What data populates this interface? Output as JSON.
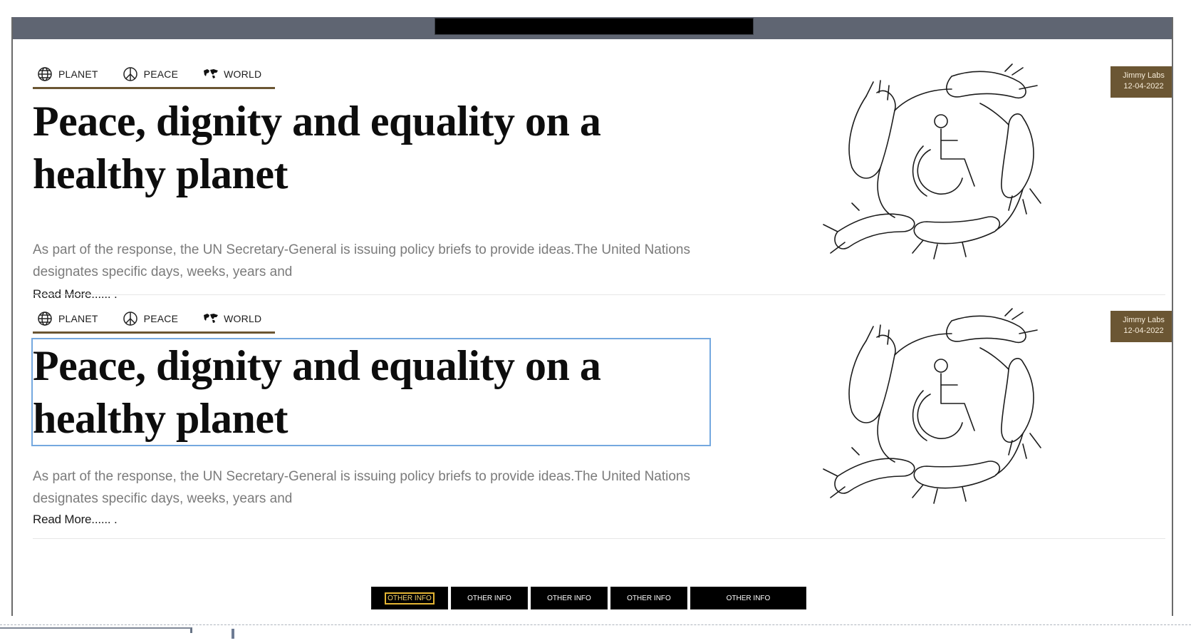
{
  "articles": [
    {
      "tags": [
        {
          "label": "PLANET",
          "icon": "globe-icon"
        },
        {
          "label": "PEACE",
          "icon": "peace-icon"
        },
        {
          "label": "WORLD",
          "icon": "world-map-icon"
        }
      ],
      "headline": "Peace, dignity and equality on a healthy planet",
      "excerpt": "As part of the response, the UN Secretary-General is issuing policy briefs to provide ideas.The United Nations designates specific days, weeks, years and",
      "read_more": "Read More...... .",
      "author": "Jimmy Labs",
      "date": "12-04-2022",
      "illustration": "hands-around-wheelchair-icon"
    },
    {
      "tags": [
        {
          "label": "PLANET",
          "icon": "globe-icon"
        },
        {
          "label": "PEACE",
          "icon": "peace-icon"
        },
        {
          "label": "WORLD",
          "icon": "world-map-icon"
        }
      ],
      "headline": "Peace, dignity and equality on a healthy planet",
      "excerpt": "As part of the response, the UN Secretary-General is issuing policy briefs to provide ideas.The United Nations designates specific days, weeks, years and",
      "read_more": "Read More...... .",
      "author": "Jimmy Labs",
      "date": "12-04-2022",
      "illustration": "hands-around-wheelchair-icon"
    }
  ],
  "bottom_nav": [
    {
      "label": "OTHER INFO"
    },
    {
      "label": "OTHER INFO"
    },
    {
      "label": "OTHER INFO"
    },
    {
      "label": "OTHER INFO"
    },
    {
      "label": "OTHER INFO"
    }
  ],
  "colors": {
    "accent_brown": "#6b5633",
    "top_bar": "#5f6572",
    "focus_outline": "#74a8df",
    "active_nav": "#e4b533"
  }
}
